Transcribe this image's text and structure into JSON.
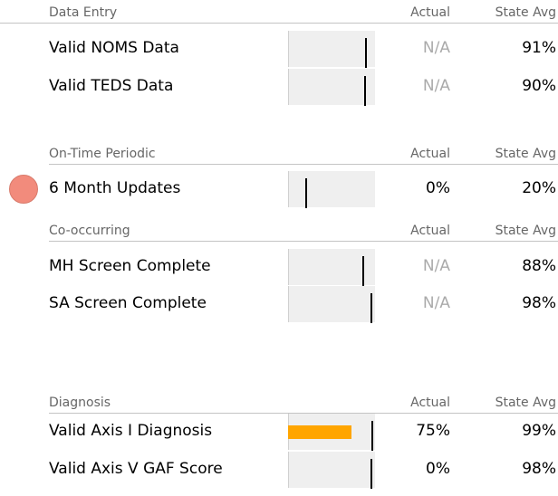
{
  "columns": {
    "actual": "Actual",
    "state_avg": "State Avg"
  },
  "colors": {
    "fill": "#ffa500",
    "alert": "#f28b7c",
    "na_text": "#aaaaaa"
  },
  "sections": [
    {
      "title": "Data Entry",
      "rows": [
        {
          "label": "Valid NOMS Data",
          "actual": "N/A",
          "state_avg": "91%",
          "actual_fraction": 0,
          "state_fraction": 0.91
        },
        {
          "label": "Valid TEDS Data",
          "actual": "N/A",
          "state_avg": "90%",
          "actual_fraction": 0,
          "state_fraction": 0.9
        }
      ]
    },
    {
      "title": "On-Time Periodic",
      "alert": true,
      "rows": [
        {
          "label": "6 Month Updates",
          "actual": "0%",
          "state_avg": "20%",
          "actual_fraction": 0,
          "state_fraction": 0.2
        }
      ]
    },
    {
      "title": "Co-occurring",
      "rows": [
        {
          "label": "MH Screen Complete",
          "actual": "N/A",
          "state_avg": "88%",
          "actual_fraction": 0,
          "state_fraction": 0.88
        },
        {
          "label": "SA Screen Complete",
          "actual": "N/A",
          "state_avg": "98%",
          "actual_fraction": 0,
          "state_fraction": 0.98
        }
      ]
    },
    {
      "title": "Diagnosis",
      "rows": [
        {
          "label": "Valid Axis I Diagnosis",
          "actual": "75%",
          "state_avg": "99%",
          "actual_fraction": 0.75,
          "state_fraction": 0.99
        },
        {
          "label": "Valid Axis V GAF Score",
          "actual": "0%",
          "state_avg": "98%",
          "actual_fraction": 0,
          "state_fraction": 0.98
        }
      ]
    }
  ]
}
